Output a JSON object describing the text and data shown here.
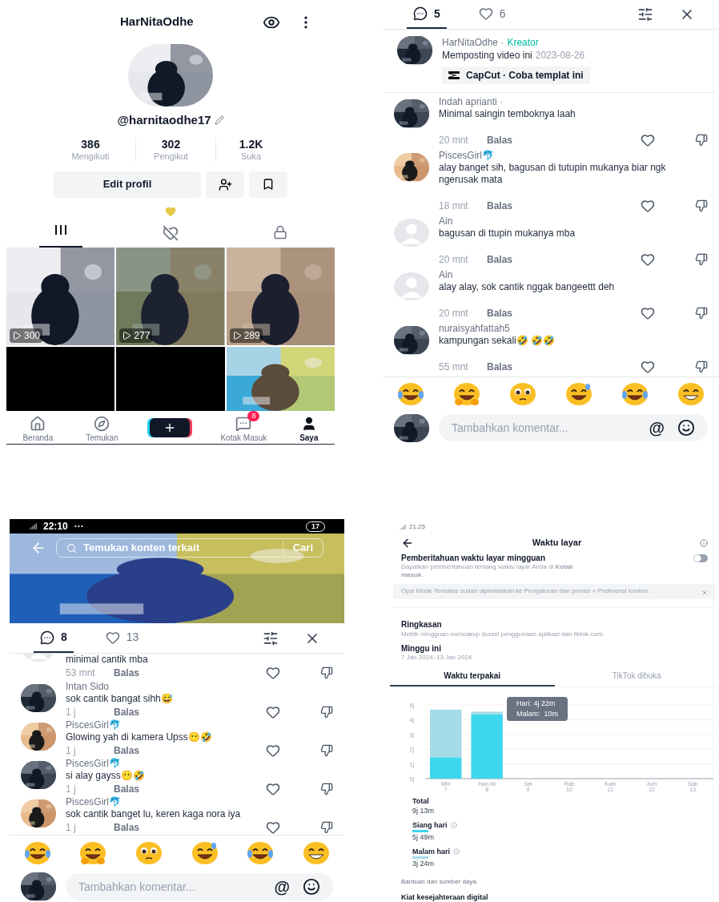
{
  "profile_screen": {
    "title": "HarNitaOdhe",
    "handle": "@harnitaodhe17",
    "stats": [
      {
        "value": "386",
        "label": "Mengikuti"
      },
      {
        "value": "302",
        "label": "Pengikut"
      },
      {
        "value": "1.2K",
        "label": "Suka"
      }
    ],
    "edit_button": "Edit profil",
    "content_tabs": [
      {
        "kind": "videos",
        "selected": true
      },
      {
        "kind": "liked",
        "selected": false
      },
      {
        "kind": "private",
        "selected": false
      }
    ],
    "videos": [
      {
        "kind": "picture",
        "views": "300"
      },
      {
        "kind": "picture",
        "views": "277"
      },
      {
        "kind": "picture",
        "views": "289"
      },
      {
        "kind": "blank"
      },
      {
        "kind": "blank"
      },
      {
        "kind": "picture"
      }
    ],
    "nav": [
      {
        "kind": "home",
        "label": "Beranda",
        "selected": false
      },
      {
        "kind": "discover",
        "label": "Temukan",
        "selected": false
      },
      {
        "kind": "create"
      },
      {
        "kind": "inbox",
        "label": "Kotak Masuk",
        "badge": "8",
        "selected": false
      },
      {
        "kind": "profile",
        "label": "Saya",
        "selected": true
      }
    ]
  },
  "comments_screen": {
    "tabs": [
      {
        "kind": "comments",
        "count": "5",
        "selected": true
      },
      {
        "kind": "likes",
        "count": "6",
        "selected": false
      }
    ],
    "creator": {
      "name": "HarNitaOdhe ·",
      "role": "Kreator",
      "posted": "Memposting video ini",
      "date": "2023-08-26",
      "template": "CapCut · Coba templat ini"
    },
    "comments": [
      {
        "author": "Indah aprianti ·",
        "text": "Minimal saingin temboknya laah",
        "time": "20 mnt",
        "reply": "Balas"
      },
      {
        "author": "PiscesGirl🐬",
        "text": "alay banget sih, bagusan di tutupin mukanya biar ngk ngerusak mata",
        "time": "18 mnt",
        "reply": "Balas"
      },
      {
        "kind": "default",
        "author": "Ain",
        "text": "bagusan di ttupin mukanya mba",
        "time": "20 mnt",
        "reply": "Balas"
      },
      {
        "kind": "default",
        "author": "Ain",
        "text": "alay alay, sok cantik nggak bangeettt deh",
        "time": "20 mnt",
        "reply": "Balas"
      },
      {
        "author": "nuraisyahfattah5",
        "text": "kampungan sekali🤣 🤣🤣",
        "time": "55 mnt",
        "reply": "Balas"
      }
    ],
    "input": {
      "placeholder": "Tambahkan komentar...",
      "mention": "@"
    }
  },
  "video_comments_screen": {
    "status_time": "22:10",
    "status_dots": "···",
    "battery": "17",
    "search": {
      "placeholder": "Temukan konten terkait",
      "button": "Cari"
    },
    "tabs": [
      {
        "kind": "comments",
        "count": "8",
        "selected": true
      },
      {
        "kind": "likes",
        "count": "13",
        "selected": false
      }
    ],
    "comments": [
      {
        "kind": "partial",
        "text": "minimal cantik mba",
        "time": "53 mnt",
        "reply": "Balas"
      },
      {
        "author": "Intan Sido",
        "text": "sok cantik bangat sihh😅",
        "time": "1 j",
        "reply": "Balas"
      },
      {
        "author": "PiscesGirl🐬",
        "text": "Glowing yah di kamera Upss😶🤣",
        "time": "1 j",
        "reply": "Balas"
      },
      {
        "author": "PiscesGirl🐬",
        "text": "si alay gayss😶🤣",
        "time": "1 j",
        "reply": "Balas"
      },
      {
        "author": "PiscesGirl🐬",
        "text": "sok cantik banget lu, keren kaga nora iya",
        "time": "1 j",
        "reply": "Balas"
      }
    ],
    "input": {
      "placeholder": "Tambahkan komentar...",
      "mention": "@"
    }
  },
  "screen_time_screen": {
    "status_time": "21.25",
    "title": "Waktu layar",
    "notification": {
      "title": "Pemberitahuan waktu layar mingguan",
      "description": "Dapatkan pemberitahuan tentang waktu layar Anda di **Kotak masuk**.",
      "on": false
    },
    "banner": "Opsi Mode Terbatas sudah dipindahkan ke Pengaturan dan privasi > Preferensi konten.",
    "summary_title": "Ringkasan",
    "summary_text": "Metrik mingguan mencakup durasi penggunaan aplikasi dan tiktok.com.",
    "week_title": "Minggu ini",
    "week_range": "7 Jan 2024–13 Jan 2024",
    "tabs": [
      {
        "label": "Waktu terpakai",
        "selected": true
      },
      {
        "label": "TikTok dibuka",
        "selected": false
      }
    ],
    "chart_data": {
      "type": "bar",
      "stacked": true,
      "categories": [
        "Min 7",
        "Hari ini 8",
        "Sel 9",
        "Rab 10",
        "Kam 11",
        "Jum 12",
        "Sab 13"
      ],
      "grid": true,
      "series": [
        {
          "name": "Siang hari",
          "color": "#3dd6ec",
          "values": [
            1.45,
            4.37,
            null,
            null,
            null,
            null,
            null
          ]
        },
        {
          "name": "Malam hari",
          "color": "#a6dbe8",
          "values": [
            3.23,
            0.17,
            null,
            null,
            null,
            null,
            null
          ]
        }
      ],
      "ylim": [
        0,
        5
      ],
      "yticks": [
        {
          "value": 0,
          "label": "0j"
        },
        {
          "value": 1,
          "label": "1j"
        },
        {
          "value": 2,
          "label": "2j"
        },
        {
          "value": 3,
          "label": "3j"
        },
        {
          "value": 4,
          "label": "4j"
        },
        {
          "value": 5,
          "label": "5j"
        }
      ]
    },
    "tooltip": [
      "Hari: 4j 22m",
      "Malam:  10m"
    ],
    "total_label": "Total",
    "total": "9j 13m",
    "breakdown": [
      {
        "value": "5j 49m"
      },
      {
        "value": "3j 24m"
      }
    ],
    "help": "Bantuan dan sumber daya",
    "tips": "Kiat kesejahteraan digital"
  }
}
